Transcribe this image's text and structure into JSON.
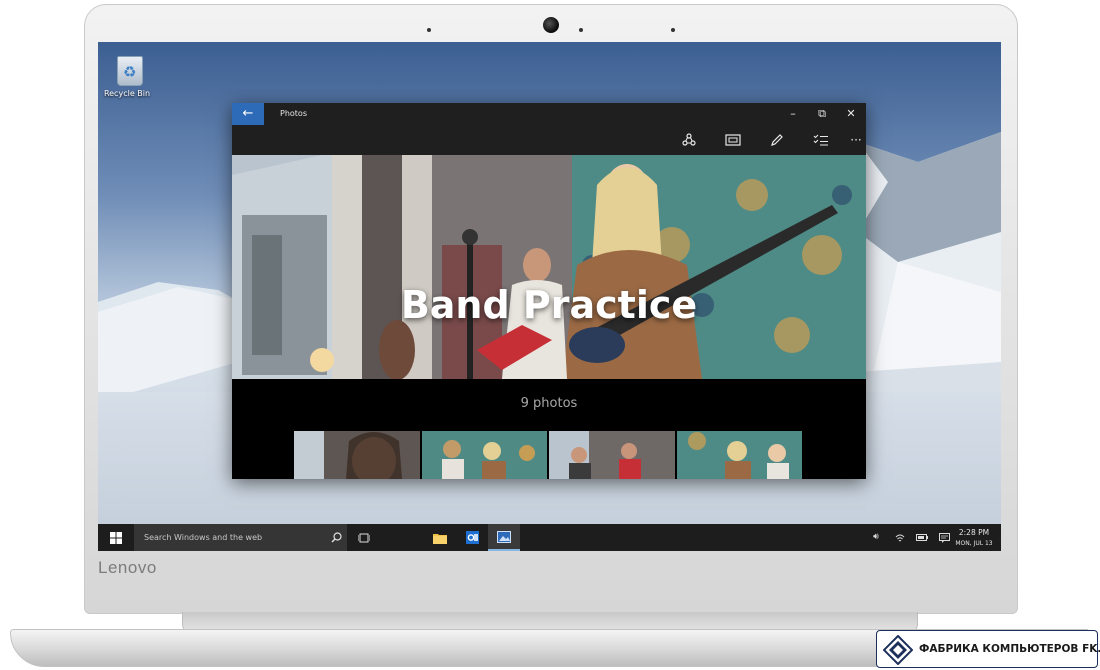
{
  "device": {
    "brand": "Lenovo"
  },
  "desktop": {
    "icons": [
      {
        "label": "Recycle Bin",
        "icon": "recycle-bin-icon"
      }
    ]
  },
  "photos_window": {
    "title": "Photos",
    "controls": {
      "minimize": "–",
      "maximize": "⧉",
      "close": "✕"
    },
    "toolbar": [
      {
        "name": "share-icon"
      },
      {
        "name": "slideshow-icon"
      },
      {
        "name": "edit-icon"
      },
      {
        "name": "select-icon"
      },
      {
        "name": "more-icon",
        "glyph": "···"
      }
    ],
    "album": {
      "title": "Band Practice",
      "count": "9 photos"
    }
  },
  "taskbar": {
    "search_placeholder": "Search Windows and the web",
    "pinned": [
      {
        "name": "task-view-icon"
      },
      {
        "name": "file-explorer-icon"
      },
      {
        "name": "outlook-icon"
      },
      {
        "name": "photos-app-icon",
        "active": true
      }
    ],
    "tray": [
      "volume-icon",
      "network-icon",
      "battery-icon",
      "action-center-icon"
    ],
    "clock": {
      "time": "2:28 PM",
      "date": "MON, JUL 13"
    }
  },
  "watermark": {
    "text": "ФАБРИКА КОМПЬЮТЕРОВ FK.BY"
  },
  "colors": {
    "accent": "#2d6ab8",
    "taskbar": "#1d1d1d",
    "titlebar": "#1f1f1f"
  }
}
